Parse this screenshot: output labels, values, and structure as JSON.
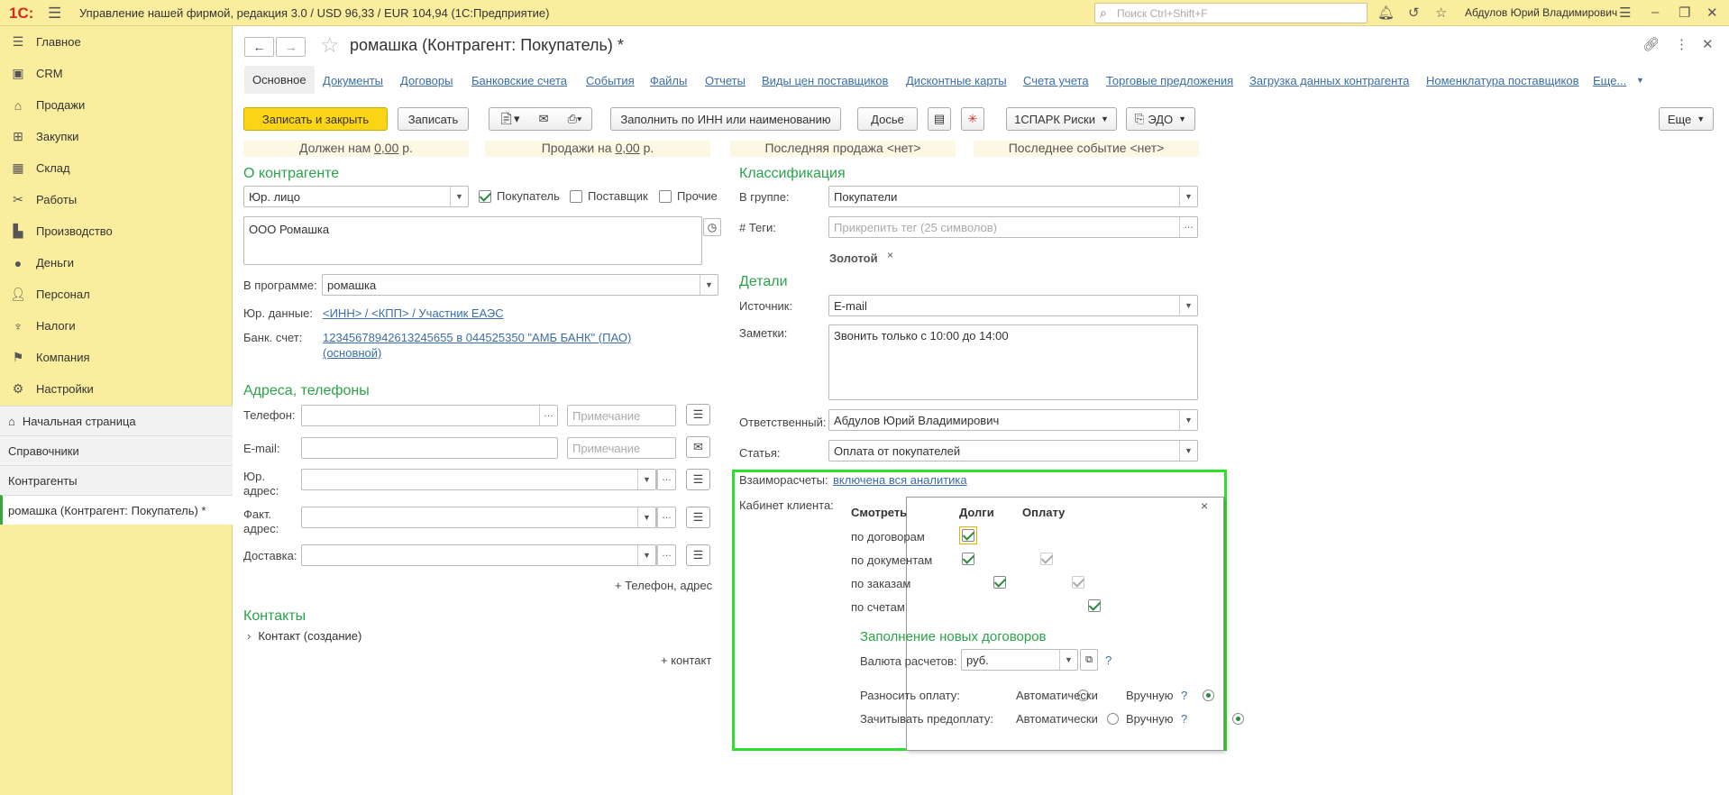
{
  "topbar": {
    "logo": "1С:",
    "title": "Управление нашей фирмой, редакция 3.0 / USD 96,33 / EUR 104,94  (1С:Предприятие)",
    "search_placeholder": "Поиск Ctrl+Shift+F",
    "user": "Абдулов Юрий Владимирович"
  },
  "sidebar": {
    "items": [
      {
        "label": "Главное",
        "icon": "menu-icon"
      },
      {
        "label": "CRM",
        "icon": "crm-icon"
      },
      {
        "label": "Продажи",
        "icon": "sales-icon"
      },
      {
        "label": "Закупки",
        "icon": "purchases-icon"
      },
      {
        "label": "Склад",
        "icon": "warehouse-icon"
      },
      {
        "label": "Работы",
        "icon": "works-icon"
      },
      {
        "label": "Производство",
        "icon": "production-icon"
      },
      {
        "label": "Деньги",
        "icon": "money-icon"
      },
      {
        "label": "Персонал",
        "icon": "personnel-icon"
      },
      {
        "label": "Налоги",
        "icon": "taxes-icon"
      },
      {
        "label": "Компания",
        "icon": "company-icon"
      },
      {
        "label": "Настройки",
        "icon": "settings-icon"
      }
    ],
    "history": [
      {
        "label": "Начальная страница"
      },
      {
        "label": "Справочники"
      },
      {
        "label": "Контрагенты"
      },
      {
        "label": "ромашка (Контрагент: Покупатель) *"
      }
    ]
  },
  "form": {
    "title": "ромашка (Контрагент: Покупатель) *",
    "tabs": [
      "Основное",
      "Документы",
      "Договоры",
      "Банковские счета",
      "События",
      "Файлы",
      "Отчеты",
      "Виды цен поставщиков",
      "Дисконтные карты",
      "Счета учета",
      "Торговые предложения",
      "Загрузка данных контрагента",
      "Номенклатура поставщиков",
      "Еще..."
    ],
    "toolbar": {
      "save_close": "Записать и закрыть",
      "save": "Записать",
      "fill_inn": "Заполнить по ИНН или наименованию",
      "dossier": "Досье",
      "spark": "1СПАРК Риски",
      "edo": "ЭДО",
      "more": "Еще"
    },
    "summary": {
      "owes_prefix": "Должен нам ",
      "owes_value": "0,00",
      "owes_suffix": " р.",
      "sales_prefix": "Продажи на ",
      "sales_value": "0,00",
      "sales_suffix": " р.",
      "last_sale": "Последняя продажа <нет>",
      "last_event": "Последнее событие <нет>"
    },
    "about": {
      "header": "О контрагенте",
      "type": "Юр. лицо",
      "buyer_label": "Покупатель",
      "supplier_label": "Поставщик",
      "other_label": "Прочие",
      "full_name": "ООО Ромашка",
      "program_label": "В программе:",
      "program_value": "ромашка",
      "legal_label": "Юр. данные:",
      "legal_link": "<ИНН> / <КПП> / Участник ЕАЭС",
      "bank_label": "Банк. счет:",
      "bank_link1": "12345678942613245655  в 044525350 \"АМБ БАНК\" (ПАО)",
      "bank_link2": "(основной)"
    },
    "addresses": {
      "header": "Адреса, телефоны",
      "phone_label": "Телефон:",
      "email_label": "E-mail:",
      "legal_addr_label1": "Юр.",
      "legal_addr_label2": "адрес:",
      "fact_addr_label1": "Факт.",
      "fact_addr_label2": "адрес:",
      "delivery_label": "Доставка:",
      "note_placeholder": "Примечание",
      "add_link": "+ Телефон, адрес"
    },
    "contacts": {
      "header": "Контакты",
      "item": "Контакт (создание)",
      "add_link": "+ контакт"
    },
    "classification": {
      "header": "Классификация",
      "group_label": "В группе:",
      "group_value": "Покупатели",
      "tags_label": "#  Теги:",
      "tags_placeholder": "Прикрепить тег (25 символов)",
      "tag": "Золотой",
      "tag_remove": "×"
    },
    "details": {
      "header": "Детали",
      "source_label": "Источник:",
      "source_value": "E-mail",
      "notes_label": "Заметки:",
      "notes_value": "Звонить только с 10:00 до 14:00",
      "responsible_label": "Ответственный:",
      "responsible_value": "Абдулов Юрий Владимирович",
      "article_label": "Статья:",
      "article_value": "Оплата от покупателей",
      "settlements_label": "Взаиморасчеты:",
      "settlements_link": "включена вся аналитика",
      "cabinet_label": "Кабинет клиента:"
    },
    "popup": {
      "col_view": "Смотреть",
      "col_debts": "Долги",
      "col_payment": "Оплату",
      "close": "×",
      "rows": [
        {
          "label": "по договорам"
        },
        {
          "label": "по документам"
        },
        {
          "label": "по заказам"
        },
        {
          "label": "по счетам"
        }
      ],
      "new_contracts_header": "Заполнение новых договоров",
      "currency_label": "Валюта расчетов:",
      "currency_value": "руб.",
      "distribute_label": "Разносить оплату:",
      "prepay_label": "Зачитывать предоплату:",
      "auto": "Автоматически",
      "manual": "Вручную",
      "help": "?"
    }
  }
}
